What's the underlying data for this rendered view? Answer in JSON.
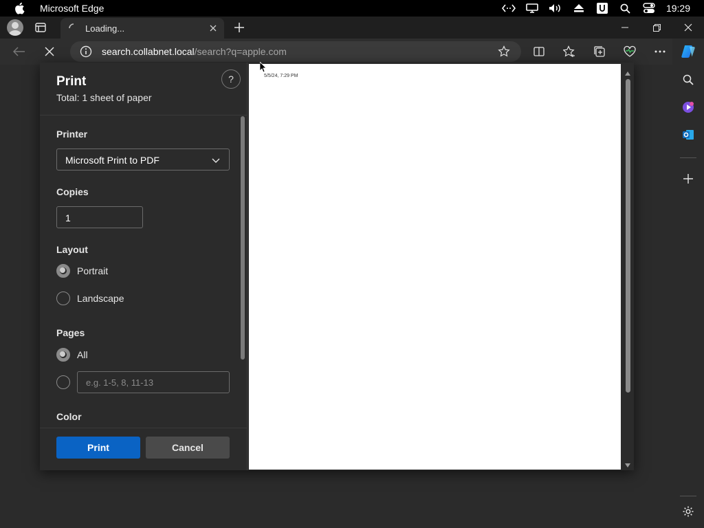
{
  "menubar": {
    "app_name": "Microsoft Edge",
    "clock": "19:29",
    "status_icons": [
      "code-icon",
      "display-icon",
      "volume-icon",
      "eject-icon",
      "u-icon",
      "search-icon",
      "control-center-icon"
    ]
  },
  "tabstrip": {
    "active_tab": {
      "title": "Loading...",
      "state": "loading"
    }
  },
  "toolbar": {
    "url_host": "search.collabnet.local",
    "url_rest": "/search?q=apple.com"
  },
  "print_dialog": {
    "title": "Print",
    "total": "Total: 1 sheet of paper",
    "help_label": "?",
    "printer": {
      "label": "Printer",
      "value": "Microsoft Print to PDF"
    },
    "copies": {
      "label": "Copies",
      "value": "1"
    },
    "layout": {
      "label": "Layout",
      "options": [
        {
          "label": "Portrait",
          "checked": true
        },
        {
          "label": "Landscape",
          "checked": false
        }
      ]
    },
    "pages": {
      "label": "Pages",
      "all_label": "All",
      "all_checked": true,
      "custom_placeholder": "e.g. 1-5, 8, 11-13"
    },
    "color": {
      "label": "Color"
    },
    "print_button": "Print",
    "cancel_button": "Cancel"
  },
  "preview": {
    "timestamp": "5/5/24, 7:29 PM"
  },
  "colors": {
    "accent": "#0a63c4",
    "dialog_bg": "#2b2b2b",
    "menubar_bg": "#000000"
  }
}
